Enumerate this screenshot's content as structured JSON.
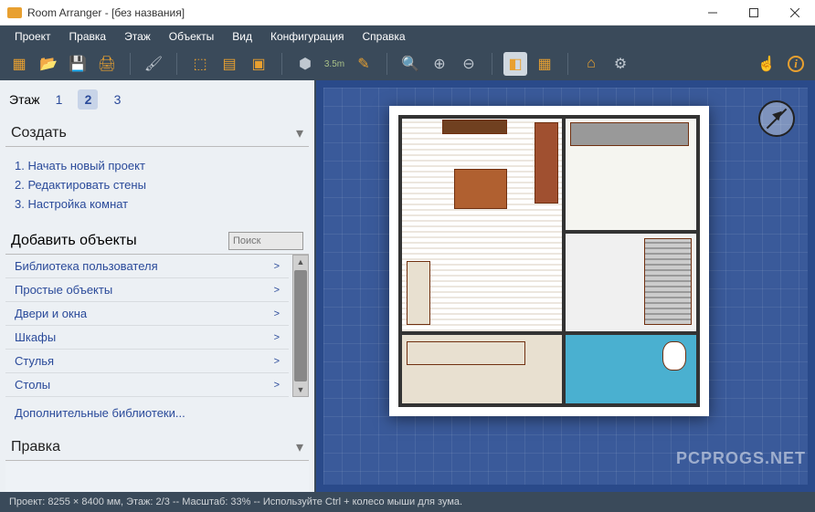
{
  "titlebar": {
    "title": "Room Arranger - [без названия]"
  },
  "menu": {
    "items": [
      "Проект",
      "Правка",
      "Этаж",
      "Объекты",
      "Вид",
      "Конфигурация",
      "Справка"
    ]
  },
  "toolbar": {
    "measure_label": "3.5m"
  },
  "sidebar": {
    "floor_label": "Этаж",
    "floors": [
      "1",
      "2",
      "3"
    ],
    "active_floor": "2",
    "create": {
      "title": "Создать",
      "items": [
        "1. Начать новый проект",
        "2. Редактировать стены",
        "3. Настройка комнат"
      ]
    },
    "add_objects": {
      "title": "Добавить объекты",
      "search_placeholder": "Поиск",
      "categories": [
        "Библиотека пользователя",
        "Простые объекты",
        "Двери и окна",
        "Шкафы",
        "Стулья",
        "Столы"
      ],
      "extra": "Дополнительные библиотеки..."
    },
    "edit": {
      "title": "Правка"
    }
  },
  "statusbar": {
    "text": "Проект: 8255 × 8400 мм, Этаж: 2/3 -- Масштаб: 33% -- Используйте Ctrl + колесо мыши для зума."
  },
  "watermark": "PCPROGS.NET"
}
